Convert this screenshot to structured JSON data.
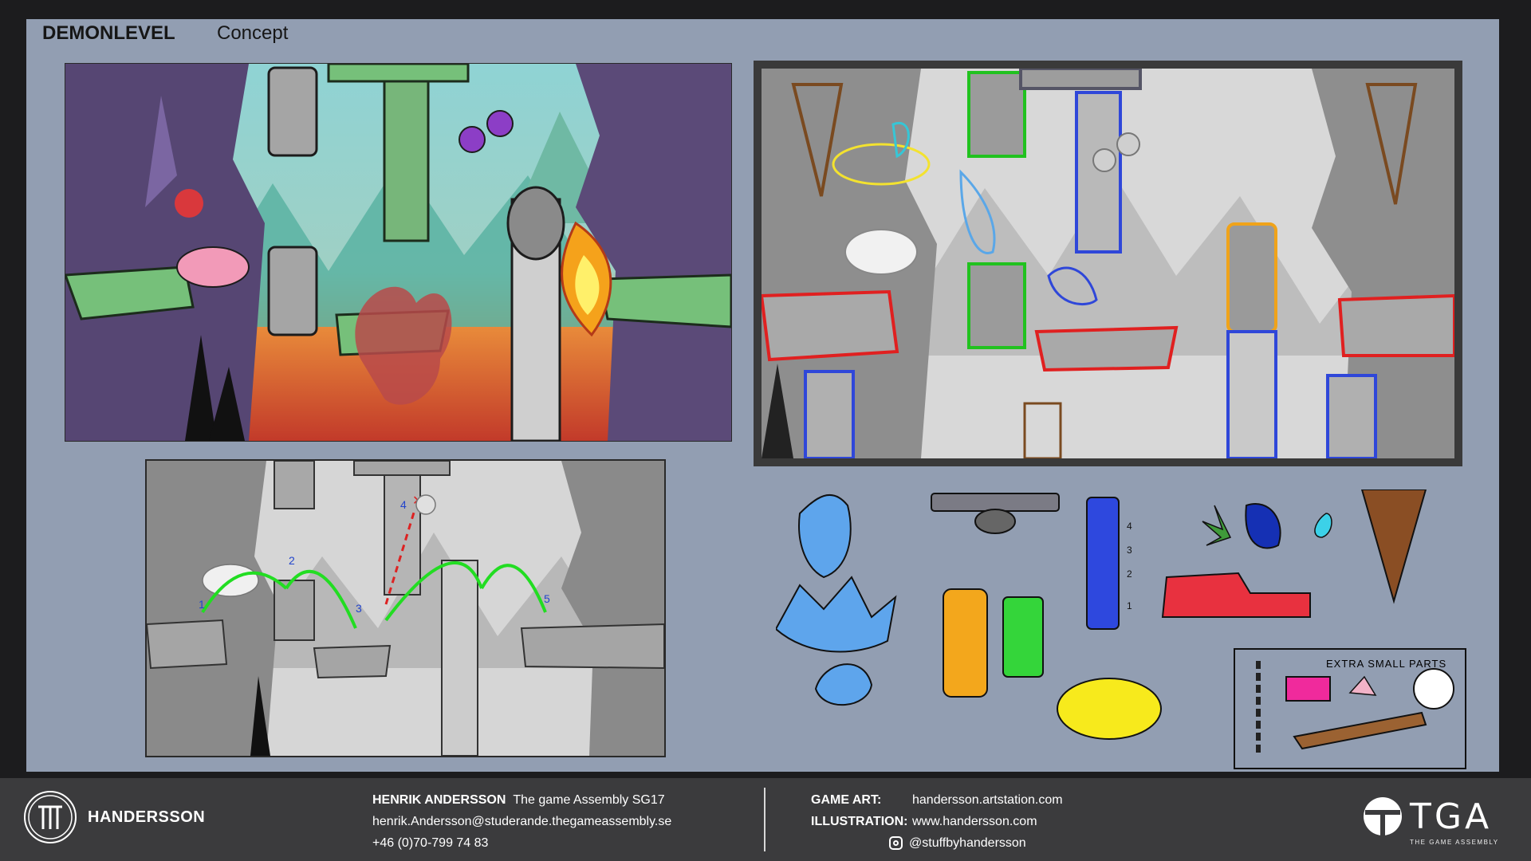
{
  "header": {
    "title": "DEMONLEVEL",
    "subtitle": "Concept"
  },
  "panels": {
    "color_concept": {
      "label": ""
    },
    "outline_breakdown": {
      "label": ""
    },
    "gameplay_path": {
      "jump_markers": [
        "1",
        "2",
        "3",
        "4",
        "5"
      ]
    }
  },
  "parts_sheet": {
    "pillar_numbers": [
      "4",
      "3",
      "2",
      "1"
    ],
    "extra_title": "EXTRA SMALL PARTS"
  },
  "footer": {
    "brand": "HANDERSSON",
    "author_name": "HENRIK ANDERSSON",
    "school": "The game Assembly SG17",
    "email": "henrik.Andersson@studerande.thegameassembly.se",
    "phone": "+46 (0)70-799 74 83",
    "game_art_label": "GAME ART:",
    "game_art_url": "handersson.artstation.com",
    "illustration_label": "ILLUSTRATION:",
    "illustration_url": "www.handersson.com",
    "instagram": "@stuffbyhandersson",
    "tga_logo": "TGA",
    "tga_sub": "THE GAME ASSEMBLY"
  },
  "colors": {
    "board": "#929eb2",
    "footer": "#3b3b3d",
    "sky_teal": "#7fc9c0",
    "platform_green": "#7dc07a",
    "stone_purple": "#5a4a7a",
    "lava_orange": "#e8772e",
    "path_green": "#22dd22",
    "path_red": "#dd2222"
  }
}
